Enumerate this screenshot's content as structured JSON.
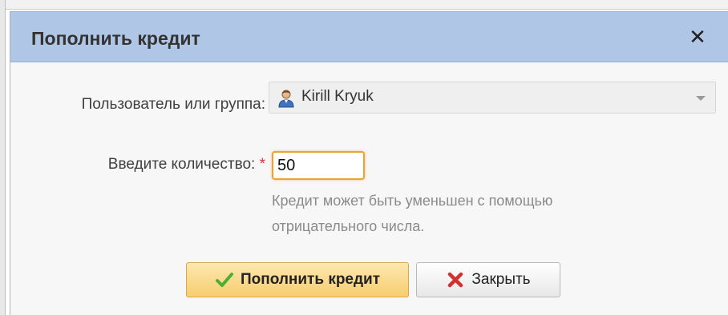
{
  "dialog": {
    "title": "Пополнить кредит",
    "close_symbol": "✕"
  },
  "form": {
    "user_label": "Пользователь или группа:",
    "user_value": "Kirill Kryuk",
    "user_icon": "user-icon",
    "amount_label": "Введите количество:",
    "required_marker": "*",
    "amount_value": "50",
    "hint": "Кредит может быть уменьшен с помощью отрицательного числа."
  },
  "buttons": {
    "submit_label": "Пополнить кредит",
    "submit_icon": "check-icon",
    "close_label": "Закрыть",
    "close_icon": "x-icon"
  },
  "colors": {
    "titlebar": "#afc6e6",
    "focus_border": "#f0a22e",
    "primary_button": "#f7cd6e",
    "required": "#d9363e",
    "check": "#4caf32",
    "x": "#d33030"
  }
}
